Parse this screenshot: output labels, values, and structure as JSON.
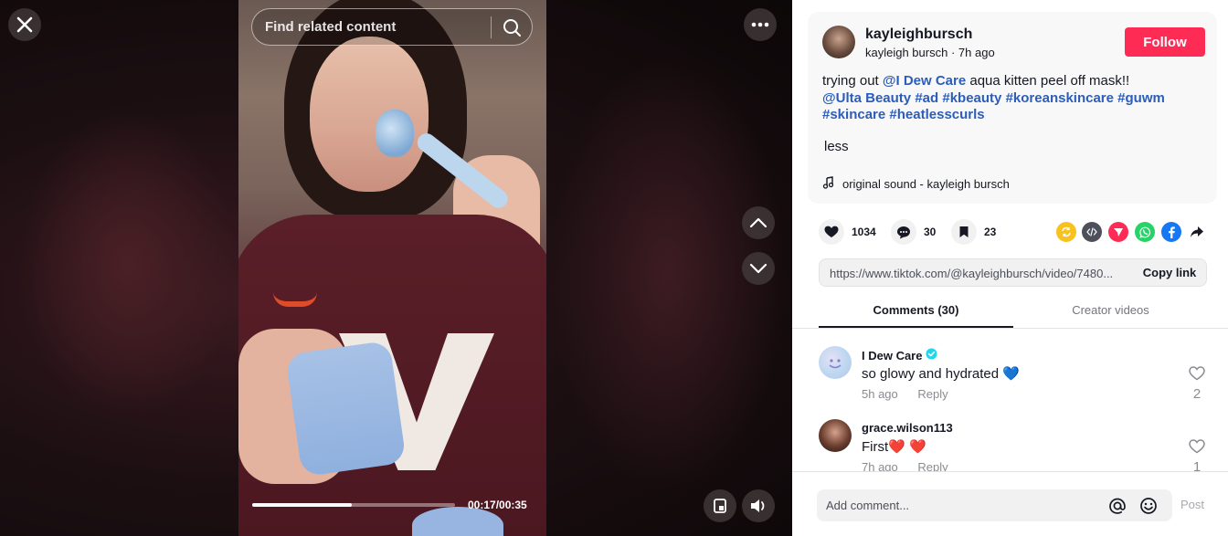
{
  "video": {
    "search_placeholder": "Find related content",
    "progress": 0.49,
    "timecode": "00:17/00:35"
  },
  "post": {
    "username": "kayleighbursch",
    "display_name": "kayleigh bursch",
    "age": "7h ago",
    "follow_label": "Follow",
    "caption": {
      "prefix": "trying out ",
      "mention1": "@I Dew Care",
      "middle": " aqua kitten peel off mask!!",
      "tags": [
        "@Ulta Beauty",
        "#ad",
        "#kbeauty",
        "#koreanskincare",
        "#guwm",
        "#skincare",
        "#heatlesscurls"
      ]
    },
    "less_label": "less",
    "sound": "original sound - kayleigh bursch"
  },
  "stats": {
    "likes": "1034",
    "comments": "30",
    "saves": "23"
  },
  "share_icons": [
    "repost-icon",
    "embed-icon",
    "send-icon",
    "whatsapp-icon",
    "facebook-icon",
    "share-arrow-icon"
  ],
  "link": {
    "url": "https://www.tiktok.com/@kayleighbursch/video/7480...",
    "copy_label": "Copy link"
  },
  "tabs": {
    "comments": "Comments (30)",
    "creator": "Creator videos"
  },
  "comments": [
    {
      "name": "I Dew Care",
      "verified": true,
      "text": "so glowy and hydrated",
      "emoji": "💙",
      "time": "5h ago",
      "reply": "Reply",
      "likes": "2"
    },
    {
      "name": "grace.wilson113",
      "verified": false,
      "text": "First",
      "emoji": "❤️ ❤️",
      "time": "7h ago",
      "reply": "Reply",
      "likes": "1"
    }
  ],
  "composer": {
    "placeholder": "Add comment...",
    "post_label": "Post"
  },
  "colors": {
    "accent": "#fe2c55",
    "link": "#2b5db9",
    "text": "#161823"
  }
}
